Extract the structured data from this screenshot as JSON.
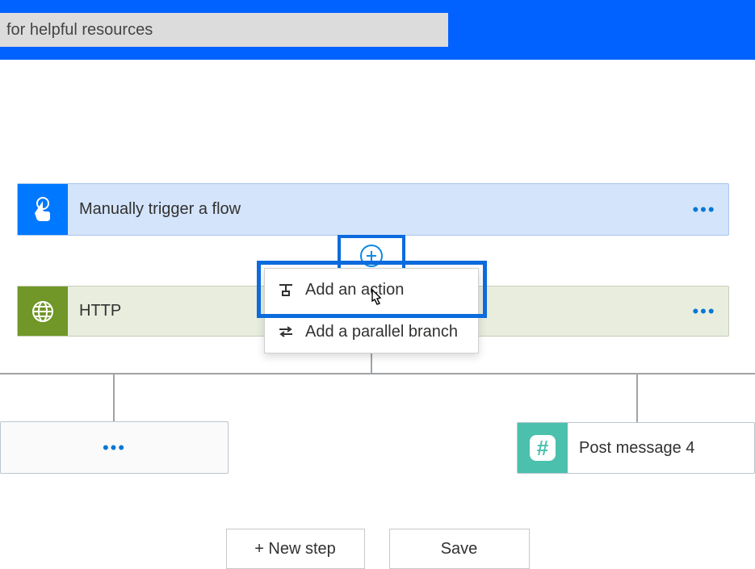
{
  "search": {
    "value": "for helpful resources"
  },
  "steps": {
    "trigger": {
      "label": "Manually trigger a flow"
    },
    "http": {
      "label": "HTTP"
    },
    "post": {
      "label": "Post message 4"
    }
  },
  "popup": {
    "add_action": "Add an action",
    "add_parallel": "Add a parallel branch"
  },
  "buttons": {
    "new_step": "+ New step",
    "save": "Save"
  },
  "colors": {
    "accent": "#0262ff",
    "trigger_icon_bg": "#0078ff",
    "http_icon_bg": "#709727",
    "post_icon_bg": "#4bc0ad"
  }
}
